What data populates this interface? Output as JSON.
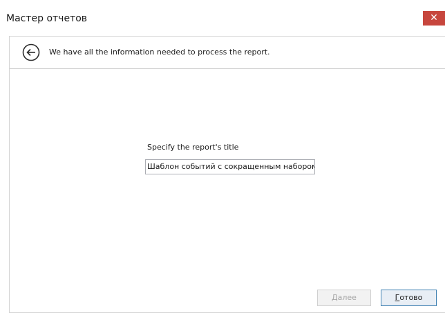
{
  "window": {
    "title": "Мастер отчетов",
    "close_label": "✕"
  },
  "header": {
    "back_icon": "back-arrow-circle-icon",
    "message": "We have all the information needed to process the report."
  },
  "form": {
    "label": "Specify the report's title",
    "title_value": "Шаблон событий с сокращенным набором да"
  },
  "buttons": {
    "next_mnemonic": "Д",
    "next_rest": "алее",
    "next_enabled": false,
    "done_mnemonic": "Г",
    "done_rest": "отово"
  },
  "colors": {
    "close_bg": "#c7463d",
    "done_border": "#3c7fb1",
    "disabled_text": "#a6a6a6"
  }
}
